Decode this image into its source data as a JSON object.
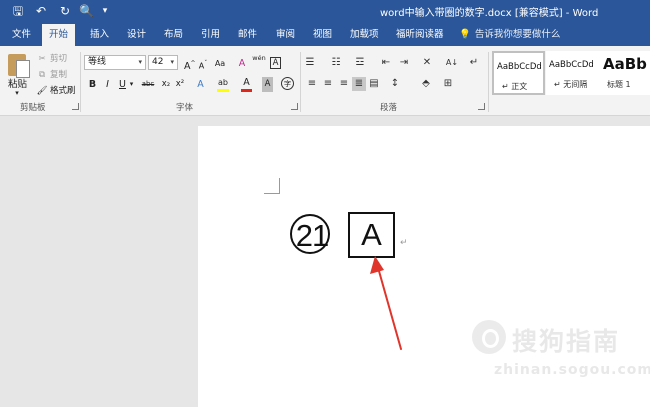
{
  "title_bar": {
    "document_title": "word中输入带圈的数字.docx [兼容模式] - Word",
    "quick_access": [
      {
        "name": "save-icon",
        "glyph": "🖫"
      },
      {
        "name": "undo-icon",
        "glyph": "↶"
      },
      {
        "name": "redo-icon",
        "glyph": "↻"
      },
      {
        "name": "print-preview-icon",
        "glyph": "🔍"
      },
      {
        "name": "customize-icon",
        "glyph": "▾"
      }
    ],
    "background": "#2b579a"
  },
  "tabs": [
    {
      "label": "文件"
    },
    {
      "label": "开始",
      "active": true
    },
    {
      "label": "插入"
    },
    {
      "label": "设计"
    },
    {
      "label": "布局"
    },
    {
      "label": "引用"
    },
    {
      "label": "邮件"
    },
    {
      "label": "审阅"
    },
    {
      "label": "视图"
    },
    {
      "label": "加载项"
    },
    {
      "label": "福昕阅读器"
    }
  ],
  "tell_me": {
    "text": "告诉我你想要做什么",
    "icon": "lightbulb-icon"
  },
  "clipboard": {
    "paste_label": "粘贴",
    "paste_arrow": "▾",
    "cut_label": "剪切",
    "copy_label": "复制",
    "format_painter_label": "格式刷",
    "cut_icon": "✂",
    "copy_icon": "⧉",
    "format_painter_icon": "🖌",
    "group_label": "剪贴板"
  },
  "font": {
    "font_name": "等线",
    "font_size": "42",
    "dropdown_arrow": "▾",
    "grow_label": "A",
    "grow_mark": "^",
    "shrink_label": "A",
    "shrink_mark": "ˇ",
    "change_case_label": "Aa",
    "clear_format_label": "A",
    "phonetic_label": "wén",
    "char_border_label": "A",
    "bold_label": "B",
    "italic_label": "I",
    "underline_label": "U",
    "strike_label": "abc",
    "subscript_label": "x₂",
    "superscript_label": "x²",
    "text_effect_label": "A",
    "highlight_label": "ab",
    "font_color_label": "A",
    "char_shading_label": "A",
    "enclose_label": "字",
    "highlight_color": "#ffff00",
    "font_color": "#e0261b",
    "group_label": "字体"
  },
  "paragraph": {
    "bullets_glyph": "☰",
    "numbering_glyph": "☷",
    "multilevel_glyph": "☲",
    "decrease_indent_glyph": "⇤",
    "increase_indent_glyph": "⇥",
    "chinese_layout_glyph": "✕",
    "sort_glyph": "A↓",
    "show_marks_glyph": "↵",
    "align_left_glyph": "≡",
    "center_glyph": "≡",
    "align_right_glyph": "≡",
    "justify_glyph": "≣",
    "distributed_glyph": "▤",
    "line_spacing_glyph": "↕",
    "shading_glyph": "⬘",
    "borders_glyph": "⊞",
    "group_label": "段落"
  },
  "styles": [
    {
      "sample": "AaBbCcDd",
      "name": "↵ 正文",
      "selected": true
    },
    {
      "sample": "AaBbCcDd",
      "name": "↵ 无间隔",
      "selected": false
    },
    {
      "sample": "AaBb",
      "name": "标题 1",
      "selected": false
    }
  ],
  "document": {
    "enclosed_number": "21",
    "enclosed_letter": "A",
    "paragraph_mark": "↵",
    "arrow_color": "#e0352b"
  },
  "watermark": {
    "name": "搜狗指南",
    "site": "zhinan.sogou.com"
  }
}
